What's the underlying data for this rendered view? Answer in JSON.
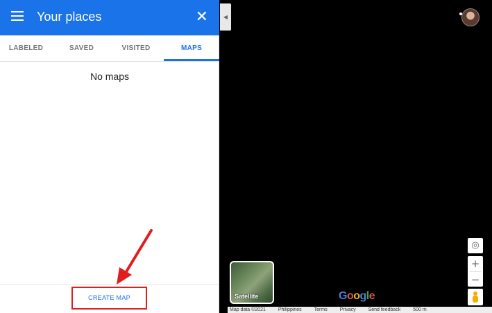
{
  "header": {
    "title": "Your places",
    "close_glyph": "✕"
  },
  "tabs": [
    {
      "label": "LABELED",
      "active": false
    },
    {
      "label": "SAVED",
      "active": false
    },
    {
      "label": "VISITED",
      "active": false
    },
    {
      "label": "MAPS",
      "active": true
    }
  ],
  "content": {
    "empty_message": "No maps"
  },
  "footer": {
    "create_label": "CREATE MAP"
  },
  "map": {
    "collapse_glyph": "◀",
    "controls": {
      "locate_glyph": "◎",
      "zoom_in": "+",
      "zoom_out": "−"
    },
    "layer_toggle_label": "Satellite",
    "logo": [
      "G",
      "o",
      "o",
      "g",
      "l",
      "e"
    ],
    "footer_links": [
      "Map data ©2021",
      "Philippines",
      "Terms",
      "Privacy",
      "Send feedback",
      "500 m"
    ]
  },
  "colors": {
    "accent": "#1a73e8",
    "annotation": "#e01e1e"
  }
}
